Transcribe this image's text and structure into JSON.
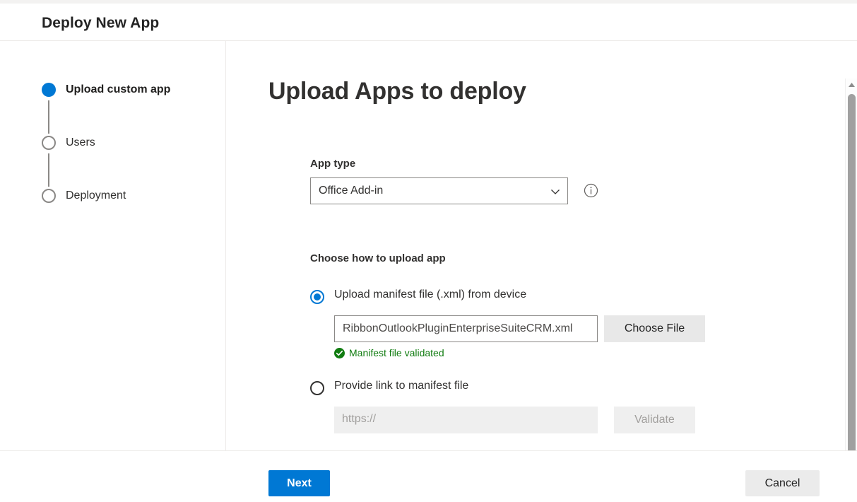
{
  "window": {
    "title": "Deploy New App"
  },
  "stepper": {
    "steps": [
      {
        "label": "Upload custom app",
        "state": "active"
      },
      {
        "label": "Users",
        "state": "inactive"
      },
      {
        "label": "Deployment",
        "state": "inactive"
      }
    ]
  },
  "main": {
    "heading": "Upload Apps to deploy",
    "app_type": {
      "label": "App type",
      "selected": "Office Add-in",
      "options": [
        "Office Add-in"
      ],
      "chevron_icon": "chevron-down-icon",
      "info_icon": "info-circle-icon"
    },
    "upload_section": {
      "label": "Choose how to upload app",
      "options": [
        {
          "label": "Upload manifest file (.xml) from device",
          "selected": true,
          "file_name": "RibbonOutlookPluginEnterpriseSuiteCRM.xml",
          "choose_button": "Choose File",
          "validation_text": "Manifest file validated",
          "validation_icon": "check-circle-icon"
        },
        {
          "label": "Provide link to manifest file",
          "selected": false,
          "url_placeholder": "https://",
          "url_value": "",
          "validate_button": "Validate",
          "disabled": true
        }
      ]
    }
  },
  "footer": {
    "next_label": "Next",
    "cancel_label": "Cancel"
  },
  "scrollbar": {
    "up_arrow_icon": "caret-up-icon",
    "down_arrow_icon": "caret-down-icon"
  },
  "colors": {
    "accent": "#0078d4",
    "success": "#107c10",
    "divider": "#edebe9",
    "disabled_bg": "#efefef"
  }
}
